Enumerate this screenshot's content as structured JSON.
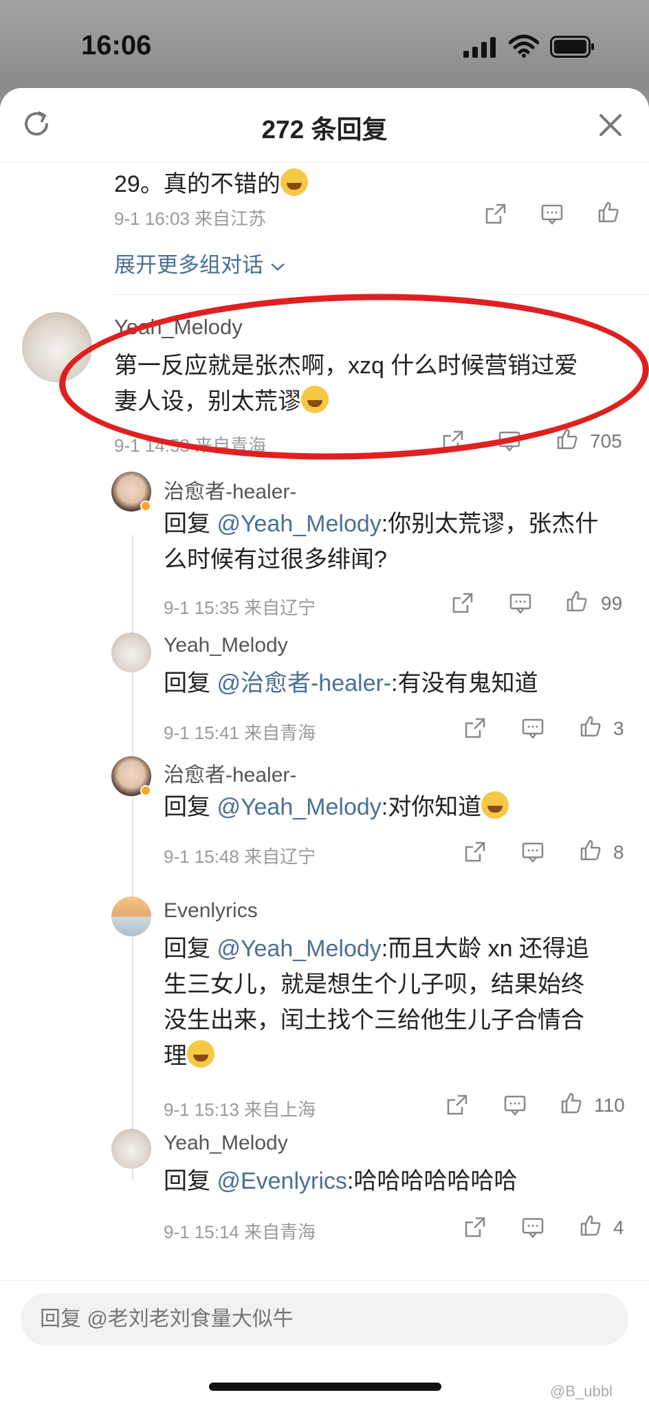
{
  "status_bar": {
    "time": "16:06"
  },
  "header": {
    "title": "272 条回复"
  },
  "top_comment": {
    "text": "29。真的不错的",
    "date": "9-1 16:03",
    "location": "来自江苏",
    "expand_label": "展开更多组对话"
  },
  "main_comment": {
    "author": "Yeah_Melody",
    "text_line1": "第一反应就是张杰啊，xzq 什么时候营销过爱",
    "text_line2": "妻人设，别太荒谬",
    "date": "9-1 14:53",
    "location": "来自青海",
    "likes": "705"
  },
  "replies": [
    {
      "author": "治愈者-healer-",
      "prefix": "回复 ",
      "mention": "@Yeah_Melody",
      "text": ":你别太荒谬，张杰什",
      "text2": "么时候有过很多绯闻?",
      "date": "9-1 15:35",
      "location": "来自辽宁",
      "likes": "99"
    },
    {
      "author": "Yeah_Melody",
      "prefix": "回复 ",
      "mention": "@治愈者-healer-",
      "text": ":有没有鬼知道",
      "date": "9-1 15:41",
      "location": "来自青海",
      "likes": "3"
    },
    {
      "author": "治愈者-healer-",
      "prefix": "回复 ",
      "mention": "@Yeah_Melody",
      "text": ":对你知道",
      "date": "9-1 15:48",
      "location": "来自辽宁",
      "likes": "8"
    },
    {
      "author": "Evenlyrics",
      "prefix": "回复 ",
      "mention": "@Yeah_Melody",
      "text": ":而且大龄 xn 还得追",
      "text2": "生三女儿，就是想生个儿子呗，结果始终",
      "text3": "没生出来，闰土找个三给他生儿子合情合",
      "text4": "理",
      "date": "9-1 15:13",
      "location": "来自上海",
      "likes": "110"
    },
    {
      "author": "Yeah_Melody",
      "prefix": "回复 ",
      "mention": "@Evenlyrics",
      "text": ":哈哈哈哈哈哈哈",
      "date": "9-1 15:14",
      "location": "来自青海",
      "likes": "4"
    }
  ],
  "input": {
    "placeholder": "回复 @老刘老刘食量大似牛"
  },
  "watermark": "@B_ubbl",
  "colors": {
    "accent": "#4a6f95",
    "highlight": "#e02020"
  }
}
